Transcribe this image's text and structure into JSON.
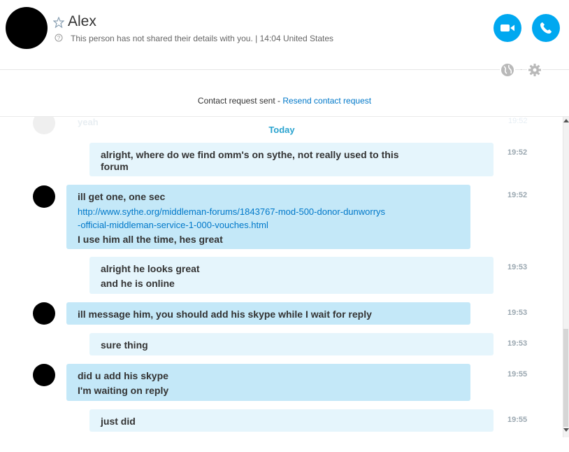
{
  "header": {
    "contact_name": "Alex",
    "status_text": "This person has not shared their details with you.  |  14:04 United States"
  },
  "notice": {
    "text": "Contact request sent - ",
    "link": "Resend contact request"
  },
  "chat": {
    "ghost_message": "yeah",
    "ghost_time": "19:52",
    "day_separator": "Today",
    "messages": [
      {
        "lines": [
          "alright, where do we find omm's on sythe, not really used to this",
          "forum"
        ],
        "time": "19:52"
      },
      {
        "lines": [
          "ill get one, one sec"
        ],
        "url": [
          "http://www.sythe.org/middleman-forums/1843767-mod-500-donor-dunworrys",
          "-official-middleman-service-1-000-vouches.html"
        ],
        "after": "I use him all the time, hes great",
        "time": "19:52"
      },
      {
        "lines": [
          "alright he looks great",
          "and he is online"
        ],
        "time": "19:53"
      },
      {
        "lines": [
          "ill message him,  you should add his skype while I wait for reply"
        ],
        "time": "19:53"
      },
      {
        "lines": [
          "sure thing"
        ],
        "time": "19:53"
      },
      {
        "lines": [
          "did u add his skype",
          "I'm waiting on reply"
        ],
        "time": "19:55"
      },
      {
        "lines": [
          "just did"
        ],
        "time": "19:55"
      }
    ]
  },
  "colors": {
    "accent": "#00a8f0",
    "mine_bubble": "#e5f5fc",
    "their_bubble": "#c4e8f8",
    "link": "#0078c9"
  },
  "icons": [
    "star-icon",
    "info-icon",
    "video-icon",
    "phone-icon",
    "globe-icon",
    "gear-icon"
  ]
}
